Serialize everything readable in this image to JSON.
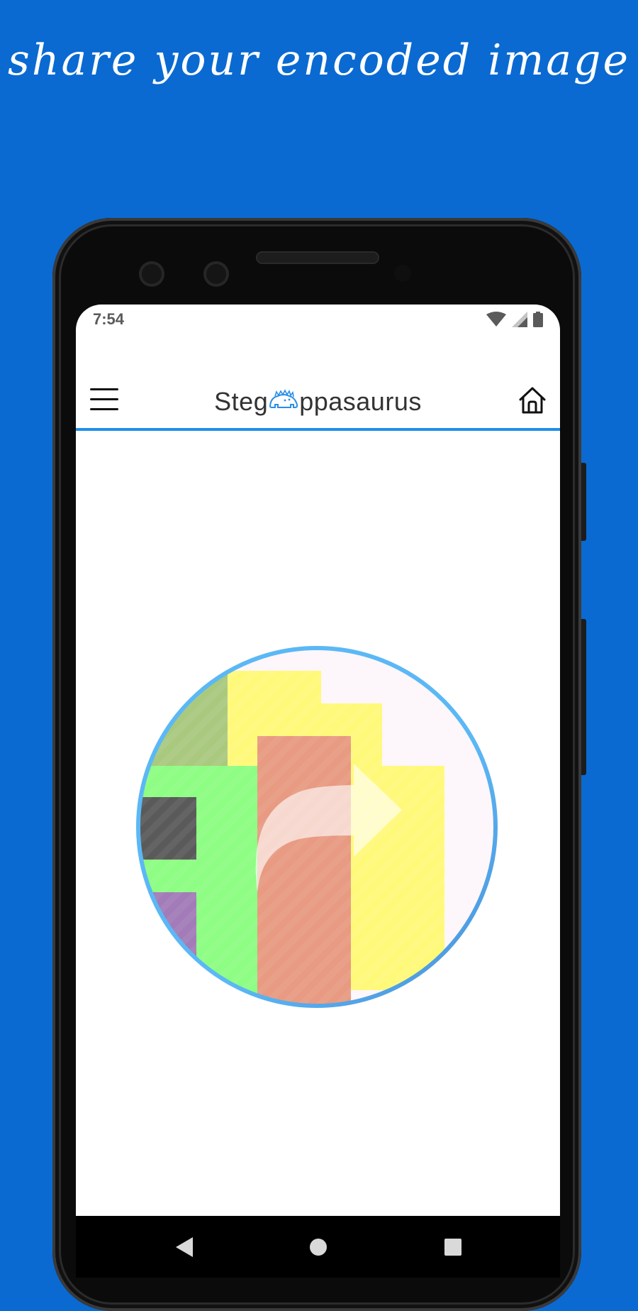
{
  "promo": {
    "tagline": "share your encoded image"
  },
  "statusbar": {
    "time": "7:54",
    "icons": [
      "wifi-icon",
      "cell-signal-icon",
      "battery-icon"
    ]
  },
  "appbar": {
    "menu_icon": "hamburger-menu-icon",
    "logo_left": "Steg",
    "logo_right": "ppasaurus",
    "home_icon": "home-icon"
  },
  "main": {
    "share_button_icon": "share-arrow-icon"
  },
  "navbar": {
    "icons": [
      "back-triangle-icon",
      "home-circle-icon",
      "recents-square-icon"
    ]
  },
  "colors": {
    "background": "#0a6ad1",
    "accent": "#1e8fe8",
    "circle_border": "#5bb8f5",
    "mosaic_yellow": "#fff97a",
    "mosaic_green": "#8dfd83",
    "mosaic_salmon": "#e89a82",
    "mosaic_olive": "#a9c97f",
    "mosaic_gray": "#5a5a5a",
    "mosaic_purple": "#a27bb8"
  }
}
